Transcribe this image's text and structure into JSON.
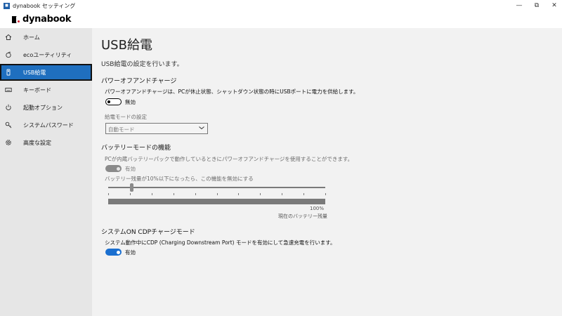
{
  "window": {
    "icon_text": "■",
    "title": "dynabook セッティング",
    "minimize": "—",
    "maximize": "⧉",
    "close": "✕"
  },
  "brand": {
    "name": "dynabook"
  },
  "sidebar": {
    "items": [
      {
        "label": "ホーム",
        "icon": "home-icon"
      },
      {
        "label": "ecoユーティリティ",
        "icon": "eco-icon"
      },
      {
        "label": "USB給電",
        "icon": "usb-icon",
        "active": true
      },
      {
        "label": "キーボード",
        "icon": "keyboard-icon"
      },
      {
        "label": "起動オプション",
        "icon": "power-icon"
      },
      {
        "label": "システムパスワード",
        "icon": "key-icon"
      },
      {
        "label": "高度な設定",
        "icon": "gear-icon"
      }
    ]
  },
  "page": {
    "title": "USB給電",
    "subtitle": "USB給電の設定を行います。"
  },
  "power_off_charge": {
    "heading": "パワーオフアンドチャージ",
    "description": "パワーオフアンドチャージは、PCが休止状態、シャットダウン状態の時にUSBポートに電力を供給します。",
    "toggle_state": "無効",
    "mode_label": "給電モードの設定",
    "mode_value": "自動モード"
  },
  "battery_mode": {
    "heading": "バッテリーモードの機能",
    "description": "PCが内蔵バッテリーパックで動作しているときにパワーオフアンドチャージを使用することができます。",
    "toggle_state": "有効",
    "threshold_text": "バッテリー残量が10%以下になったら、この機能を無効にする",
    "threshold_percent": 10,
    "current_percent_text": "100%",
    "current_percent": 100,
    "current_label": "現在のバッテリー残量"
  },
  "cdp_mode": {
    "heading": "システムON CDPチャージモード",
    "description": "システム動作中にCDP (Charging Downstream Port) モードを有効にして急速充電を行います。",
    "toggle_state": "有効"
  },
  "colors": {
    "accent": "#1f6fbf",
    "toggle_on": "#1a6fd0",
    "disabled": "#8a8a8a"
  }
}
